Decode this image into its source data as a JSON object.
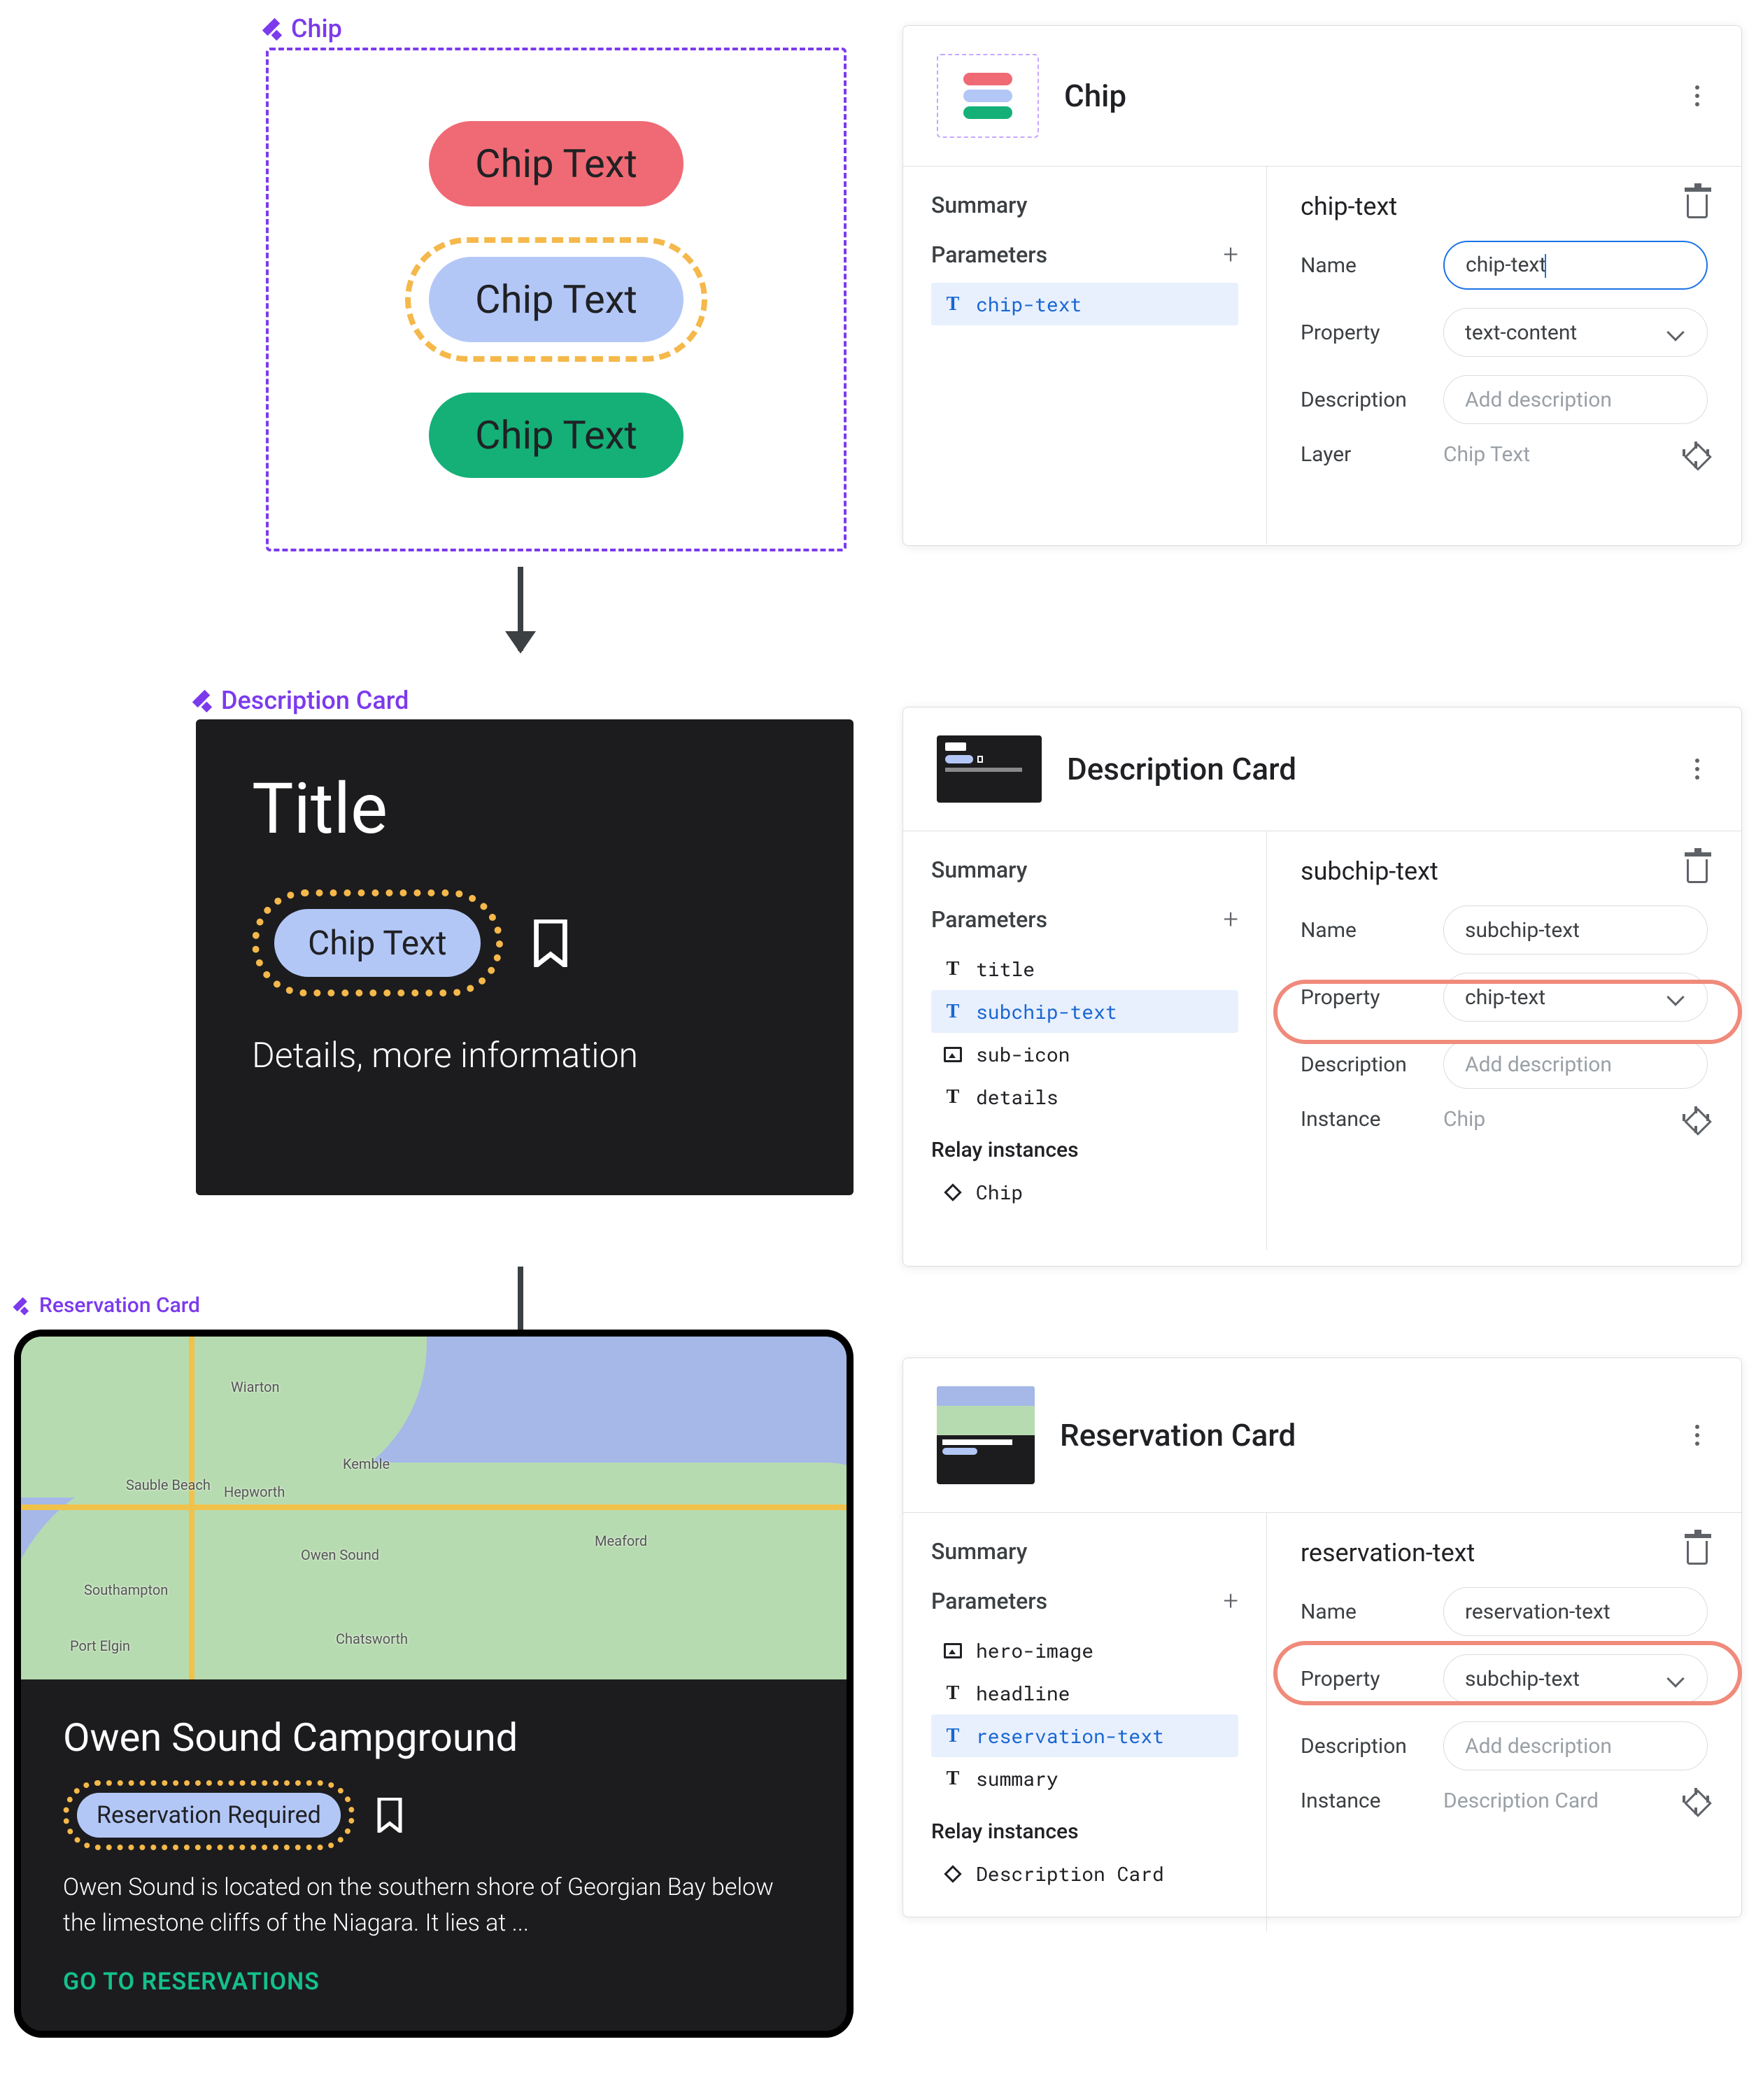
{
  "components": {
    "chip": {
      "figma_label": "Chip",
      "variants": [
        "Chip Text",
        "Chip Text",
        "Chip Text"
      ]
    },
    "description_card": {
      "figma_label": "Description Card",
      "title": "Title",
      "chip_text": "Chip Text",
      "details": "Details, more information"
    },
    "reservation_card": {
      "figma_label": "Reservation Card",
      "headline": "Owen Sound Campground",
      "reservation_text": "Reservation Required",
      "summary": "Owen Sound is located on the southern shore of Georgian Bay below the limestone cliffs of the Niagara. It lies at ...",
      "cta": "GO TO RESERVATIONS",
      "map_towns": [
        "Wiarton",
        "Sauble Beach",
        "Hepworth",
        "Kemble",
        "Owen Sound",
        "Meaford",
        "Southampton",
        "Port Elgin",
        "Chatsworth"
      ]
    }
  },
  "panels": {
    "chip": {
      "title": "Chip",
      "summary_label": "Summary",
      "parameters_label": "Parameters",
      "params": [
        {
          "icon": "T",
          "name": "chip-text",
          "selected": true
        }
      ],
      "detail": {
        "title": "chip-text",
        "name_label": "Name",
        "name_value": "chip-text",
        "property_label": "Property",
        "property_value": "text-content",
        "description_label": "Description",
        "description_placeholder": "Add description",
        "layer_label": "Layer",
        "layer_value": "Chip Text"
      }
    },
    "description": {
      "title": "Description Card",
      "summary_label": "Summary",
      "parameters_label": "Parameters",
      "params": [
        {
          "icon": "T",
          "name": "title"
        },
        {
          "icon": "T",
          "name": "subchip-text",
          "selected": true
        },
        {
          "icon": "image",
          "name": "sub-icon"
        },
        {
          "icon": "T",
          "name": "details"
        }
      ],
      "relay_label": "Relay instances",
      "relays": [
        {
          "icon": "diamond",
          "name": "Chip"
        }
      ],
      "detail": {
        "title": "subchip-text",
        "name_label": "Name",
        "name_value": "subchip-text",
        "property_label": "Property",
        "property_value": "chip-text",
        "description_label": "Description",
        "description_placeholder": "Add description",
        "instance_label": "Instance",
        "instance_value": "Chip"
      }
    },
    "reservation": {
      "title": "Reservation Card",
      "summary_label": "Summary",
      "parameters_label": "Parameters",
      "params": [
        {
          "icon": "image",
          "name": "hero-image"
        },
        {
          "icon": "T",
          "name": "headline"
        },
        {
          "icon": "T",
          "name": "reservation-text",
          "selected": true
        },
        {
          "icon": "T",
          "name": "summary"
        }
      ],
      "relay_label": "Relay instances",
      "relays": [
        {
          "icon": "diamond",
          "name": "Description Card"
        }
      ],
      "detail": {
        "title": "reservation-text",
        "name_label": "Name",
        "name_value": "reservation-text",
        "property_label": "Property",
        "property_value": "subchip-text",
        "description_label": "Description",
        "description_placeholder": "Add description",
        "instance_label": "Instance",
        "instance_value": "Description Card"
      }
    }
  },
  "colors": {
    "purple": "#7c3aed",
    "chip_red": "#ef6a74",
    "chip_blue": "#b3c7f7",
    "chip_green": "#14b078",
    "selection_dash": "#f5b84a",
    "highlight_ring": "#f08a7a",
    "dark": "#1c1c1e",
    "cta_green": "#14c08b"
  }
}
